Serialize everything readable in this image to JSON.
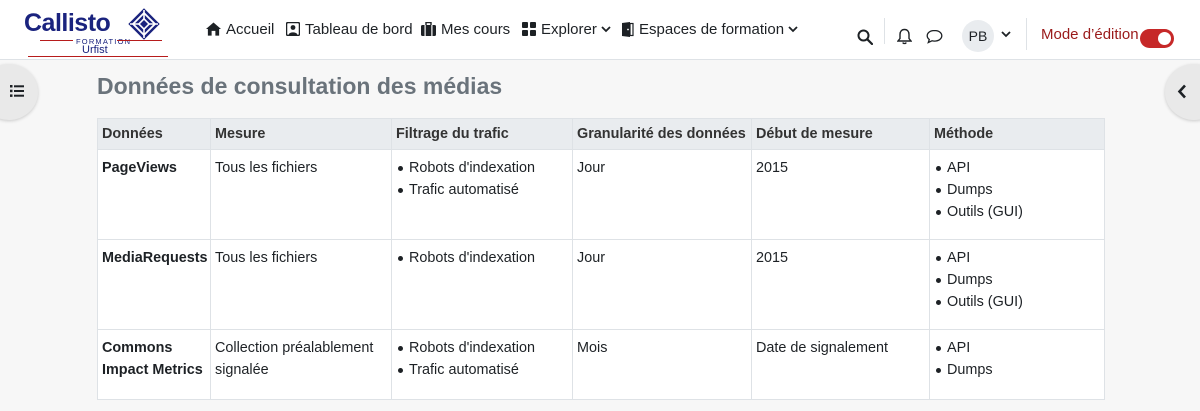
{
  "logo": {
    "brand": "Callisto",
    "tagline": "FORMATION",
    "sub": "Urfist",
    "brand_color": "#1a237e",
    "accent_color": "#b71c1c"
  },
  "nav": {
    "items": [
      {
        "label": "Accueil",
        "icon": "home-icon"
      },
      {
        "label": "Tableau de bord",
        "icon": "dashboard-icon"
      },
      {
        "label": "Mes cours",
        "icon": "briefcase-icon"
      },
      {
        "label": "Explorer",
        "icon": "grid-icon",
        "dropdown": true
      },
      {
        "label": "Espaces de formation",
        "icon": "door-icon",
        "dropdown": true
      }
    ]
  },
  "user": {
    "initials": "PB",
    "edit_mode_label": "Mode d’édition",
    "edit_mode_on": true
  },
  "page": {
    "title": "Données de consultation des médias"
  },
  "table": {
    "headers": [
      "Données",
      "Mesure",
      "Filtrage du trafic",
      "Granularité des données",
      "Début de mesure",
      "Méthode"
    ],
    "rows": [
      {
        "name": "PageViews",
        "measure": "Tous les fichiers",
        "filtering": [
          "Robots d'indexation",
          "Trafic automatisé"
        ],
        "granularity": "Jour",
        "start": "2015",
        "methods": [
          "API",
          "Dumps",
          "Outils (GUI)"
        ]
      },
      {
        "name": "MediaRequests",
        "measure": "Tous les fichiers",
        "filtering": [
          "Robots d'indexation"
        ],
        "granularity": "Jour",
        "start": "2015",
        "methods": [
          "API",
          "Dumps",
          "Outils (GUI)"
        ]
      },
      {
        "name": "Commons Impact Metrics",
        "measure": "Collection préalablement signalée",
        "filtering": [
          "Robots d'indexation",
          "Trafic automatisé"
        ],
        "granularity": "Mois",
        "start": "Date de signalement",
        "methods": [
          "API",
          "Dumps"
        ]
      }
    ]
  },
  "colors": {
    "title": "#6a737b",
    "header_bg": "#e9ecef",
    "toggle_on": "#c62828",
    "edit_label": "#9a1a1a"
  }
}
